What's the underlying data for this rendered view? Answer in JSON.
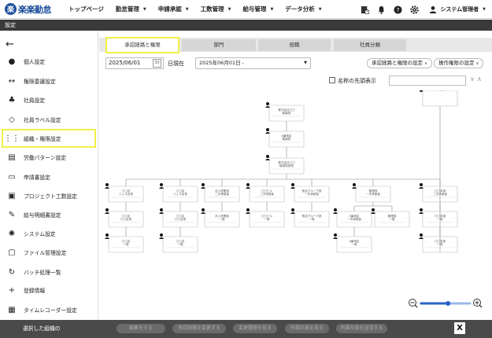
{
  "app": {
    "logo_mark": "楽",
    "logo_text": "楽楽勤怠"
  },
  "nav": [
    {
      "label": "トップページ",
      "caret": false
    },
    {
      "label": "勤怠管理",
      "caret": true
    },
    {
      "label": "申請承認",
      "caret": true
    },
    {
      "label": "工数管理",
      "caret": true
    },
    {
      "label": "給与管理",
      "caret": true
    },
    {
      "label": "データ分析",
      "caret": true
    }
  ],
  "user": {
    "name": "システム管理者",
    "icons": [
      "document-clock-icon",
      "bell-icon",
      "help-icon",
      "gear-icon",
      "user-icon"
    ]
  },
  "titlebar": {
    "title": "設定"
  },
  "sidebar": {
    "back_icon": "arrow-left-icon",
    "items": [
      {
        "label": "個人設定",
        "icon": "person-icon"
      },
      {
        "label": "権限委譲設定",
        "icon": "arrows-horizontal-icon"
      },
      {
        "label": "社員設定",
        "icon": "group-icon"
      },
      {
        "label": "社員ラベル設定",
        "icon": "tag-icon"
      },
      {
        "label": "組織・権限設定",
        "icon": "org-grid-icon"
      },
      {
        "label": "労働パターン設定",
        "icon": "list-box-icon"
      },
      {
        "label": "申請書設定",
        "icon": "document-icon"
      },
      {
        "label": "プロジェクト工数設定",
        "icon": "printer-icon"
      },
      {
        "label": "給与明細書設定",
        "icon": "edit-document-icon"
      },
      {
        "label": "システム設定",
        "icon": "gear-icon"
      },
      {
        "label": "ファイル管理設定",
        "icon": "folder-icon"
      },
      {
        "label": "バッチ処理一覧",
        "icon": "batch-icon"
      },
      {
        "label": "登録情報",
        "icon": "plus-icon"
      },
      {
        "label": "タイムレコーダー設定",
        "icon": "clock-icon"
      }
    ]
  },
  "tabs": [
    {
      "label": "承認経路と権限"
    },
    {
      "label": "部門"
    },
    {
      "label": "役職"
    },
    {
      "label": "社員分類"
    }
  ],
  "filter": {
    "date": "2025/06/01",
    "as_of_label": "日現在",
    "period_select": "2025年06月01日 -",
    "settings_btn_1": "承認経路と権限の設定",
    "settings_btn_2": "操作権限の設定",
    "prefix_checkbox_label": "名称の先頭表示",
    "search_value": ""
  },
  "org_chart": {
    "level1": [
      {
        "line1": "株式会社〇〇",
        "line2": "取締役"
      }
    ],
    "level2": [
      {
        "line1": "4番地区",
        "line2": "取締役"
      }
    ],
    "level3": [
      {
        "line1": "株式会社〇〇",
        "line2": "取締役部長"
      }
    ],
    "branches": [
      {
        "line1": "〇〇店",
        "line2": "ジェネ店長",
        "children": [
          {
            "line1": "〇〇店",
            "line2": "〇〇店長"
          },
          {
            "line1": "〇〇店",
            "line2": "一般"
          }
        ]
      },
      {
        "line1": "〇〇店",
        "line2": "ジェネ店長",
        "children": [
          {
            "line1": "〇〇店",
            "line2": "〇〇店長"
          },
          {
            "line1": "〇〇店",
            "line2": "一般"
          }
        ]
      },
      {
        "line1": "法人営業部",
        "line2": "二次承認者",
        "children": [
          {
            "line1": "法人営業部",
            "line2": "一般"
          }
        ]
      },
      {
        "line1": "〇〇ビル",
        "line2": "二次承認者",
        "children": [
          {
            "line1": "〇〇ビル",
            "line2": "一般"
          }
        ]
      },
      {
        "line1": "他店グループ部",
        "line2": "一次承認者",
        "children": [
          {
            "line1": "他店グループ部",
            "line2": "一般"
          }
        ]
      },
      {
        "line1": "管理部",
        "line2": "一次承認者",
        "children": [
          {
            "line1": "4番地区",
            "line2": "一次承認者"
          },
          {
            "line1": "管理部",
            "line2": "一般"
          },
          {
            "line1": "4番地区",
            "line2": "一般"
          }
        ]
      },
      {
        "line1": "〇〇本部",
        "line2": "二次承認者",
        "children": [
          {
            "line1": "〇〇本部",
            "line2": "一般"
          },
          {
            "line1": "〇〇本部",
            "line2": "一般"
          },
          {
            "line1": "〇〇本部",
            "line2": "一般"
          }
        ]
      }
    ]
  },
  "zoom": {
    "level": 0.55
  },
  "footer": {
    "selected_label": "選択した組織の",
    "buttons": [
      "編集をする",
      "承認経路を変更する",
      "変更履歴を見る",
      "所属社員を見る",
      "所属社員を追加する"
    ],
    "excel_label": "X"
  }
}
